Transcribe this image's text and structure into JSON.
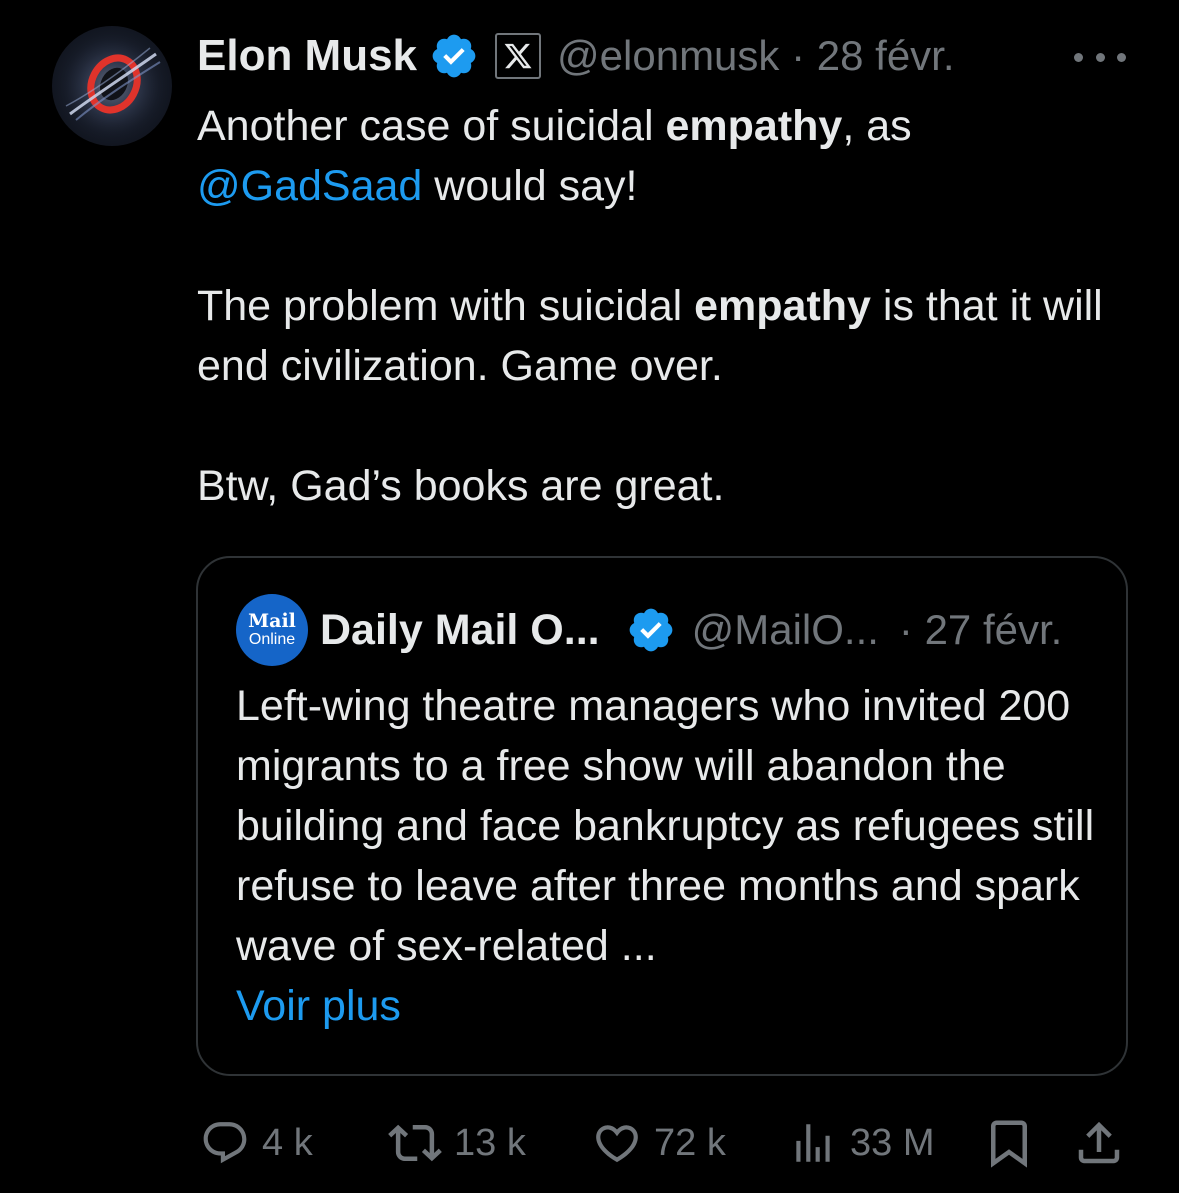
{
  "tweet": {
    "author_name": "Elon Musk",
    "handle": "@elonmusk",
    "separator": "·",
    "date": "28 févr.",
    "text": {
      "p1_a": "Another case of suicidal ",
      "p1_bold": "empathy",
      "p1_b": ", as",
      "p1_mention": "@GadSaad",
      "p1_c": " would say!",
      "p2_a": "The problem with suicidal ",
      "p2_bold": "empathy",
      "p2_b": " is that it will end civilization. Game over.",
      "p3": "Btw, Gad’s books are great."
    }
  },
  "quote": {
    "avatar_line1": "Mail",
    "avatar_line2": "Online",
    "author_name": "Daily Mail O...",
    "handle": "@MailO...",
    "date": "· 27 févr.",
    "text": "Left-wing theatre managers who invited 200 migrants to a free show will abandon the building and face bankruptcy as refugees still refuse to leave after three months and spark wave of sex-related ...",
    "more_link": "Voir plus"
  },
  "actions": {
    "replies": "4 k",
    "reposts": "13 k",
    "likes": "72 k",
    "views": "33 M"
  },
  "icons": {
    "verified": "verified-badge-icon",
    "affiliation": "x-logo-icon",
    "more": "more-options-icon",
    "reply": "reply-icon",
    "repost": "repost-icon",
    "like": "heart-icon",
    "views": "views-icon",
    "bookmark": "bookmark-icon",
    "share": "share-icon"
  },
  "colors": {
    "background": "#000000",
    "text": "#e7e9ea",
    "secondary": "#71767b",
    "accent": "#1d9bf0",
    "border": "#2f3336",
    "mail_online_blue": "#1565c8"
  }
}
